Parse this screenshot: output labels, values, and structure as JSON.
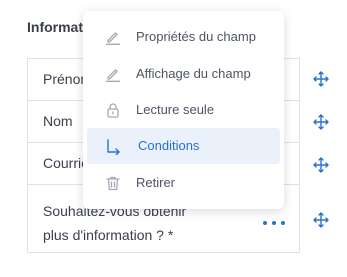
{
  "section_title": "Information",
  "fields": [
    {
      "label": "Prénom"
    },
    {
      "label": "Nom"
    },
    {
      "label": "Courriel"
    },
    {
      "label": "Souhaitez-vous obtenir plus d'information ? *"
    }
  ],
  "context_menu": {
    "items": [
      {
        "label": "Propriétés du champ",
        "icon": "edit-icon"
      },
      {
        "label": "Affichage du champ",
        "icon": "edit-icon"
      },
      {
        "label": "Lecture seule",
        "icon": "lock-icon"
      },
      {
        "label": "Conditions",
        "icon": "arrow-down-right-icon",
        "active": true
      },
      {
        "label": "Retirer",
        "icon": "trash-icon"
      }
    ]
  },
  "colors": {
    "accent": "#2a6fd6",
    "border": "#dde2ea",
    "text": "#3a3f4b",
    "active_bg": "#eaf1fb"
  }
}
